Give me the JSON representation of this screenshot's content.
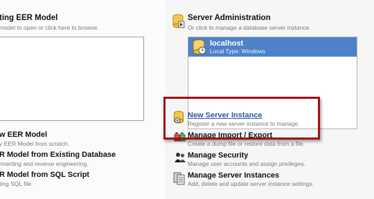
{
  "left": {
    "open_model": {
      "title": "ting EER Model",
      "subtitle": "model to open or click here to browse."
    },
    "tasks": [
      {
        "title": "w EER Model",
        "subtitle": "v EER Model from scratch."
      },
      {
        "title": "R Model from Existing Database",
        "subtitle": "nnecting and reverse engineering."
      },
      {
        "title": "R Model from SQL Script",
        "subtitle": "ting SQL file."
      }
    ]
  },
  "right": {
    "header": {
      "title": "Server Administration",
      "subtitle": "Or click to manage a database server instance."
    },
    "server": {
      "name": "localhost",
      "info": "Local  Type: Windows"
    },
    "tasks": [
      {
        "title": "New Server Instance",
        "subtitle": "Register a new server instance to manage.",
        "icon": "database-add-icon"
      },
      {
        "title": "Manage Import / Export",
        "subtitle": "Create a dump file or restore data from a file.",
        "icon": "import-export-icon"
      },
      {
        "title": "Manage Security",
        "subtitle": "Manage user accounts and assign privileges.",
        "icon": "users-icon"
      },
      {
        "title": "Manage Server Instances",
        "subtitle": "Add, delete and update server instance settings.",
        "icon": "server-instances-icon"
      }
    ]
  },
  "colors": {
    "highlight": "#a30f14",
    "selection": "#4d82c9",
    "link": "#2b59a8"
  }
}
